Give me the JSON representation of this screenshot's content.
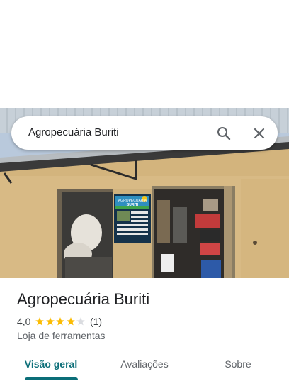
{
  "search": {
    "query": "Agropecuária Buriti"
  },
  "place": {
    "name": "Agropecuária Buriti",
    "rating": "4,0",
    "stars_filled": 4,
    "stars_total": 5,
    "review_count": "(1)",
    "category": "Loja de ferramentas"
  },
  "storefront_sign": {
    "line1": "AGROPECUÁRIA",
    "line2": "BURITI"
  },
  "tabs": [
    {
      "label": "Visão geral",
      "active": true
    },
    {
      "label": "Avaliações",
      "active": false
    },
    {
      "label": "Sobre",
      "active": false
    }
  ],
  "colors": {
    "accent": "#0b6e78",
    "star": "#fbbc04",
    "star_empty": "#dadce0"
  }
}
